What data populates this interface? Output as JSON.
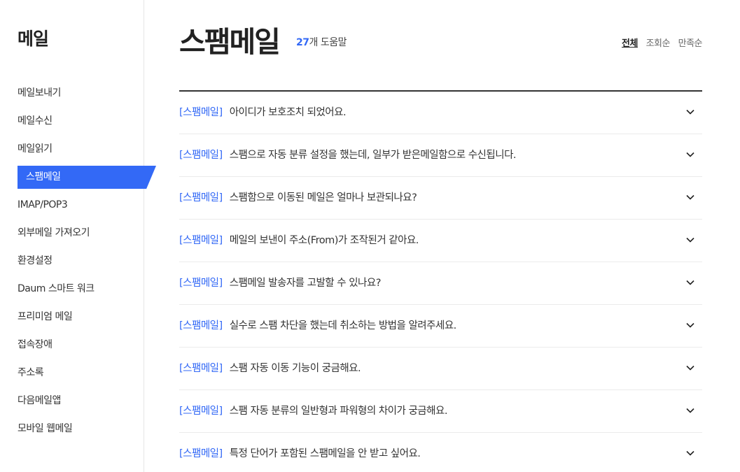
{
  "sidebar": {
    "title": "메일",
    "items": [
      {
        "label": "메일보내기",
        "active": false
      },
      {
        "label": "메일수신",
        "active": false
      },
      {
        "label": "메일읽기",
        "active": false
      },
      {
        "label": "스팸메일",
        "active": true
      },
      {
        "label": "IMAP/POP3",
        "active": false
      },
      {
        "label": "외부메일 가져오기",
        "active": false
      },
      {
        "label": "환경설정",
        "active": false
      },
      {
        "label": "Daum 스마트 워크",
        "active": false
      },
      {
        "label": "프리미엄 메일",
        "active": false
      },
      {
        "label": "접속장애",
        "active": false
      },
      {
        "label": "주소록",
        "active": false
      },
      {
        "label": "다음메일앱",
        "active": false
      },
      {
        "label": "모바일 웹메일",
        "active": false
      }
    ]
  },
  "main": {
    "title": "스팸메일",
    "count_number": "27",
    "count_suffix": "개 도움말",
    "sort": [
      {
        "label": "전체",
        "selected": true
      },
      {
        "label": "조회순",
        "selected": false
      },
      {
        "label": "만족순",
        "selected": false
      }
    ],
    "faq": [
      {
        "category": "[스팸메일]",
        "question": "아이디가 보호조치 되었어요."
      },
      {
        "category": "[스팸메일]",
        "question": "스팸으로 자동 분류 설정을 했는데, 일부가 받은메일함으로 수신됩니다."
      },
      {
        "category": "[스팸메일]",
        "question": "스팸함으로 이동된 메일은 얼마나 보관되나요?"
      },
      {
        "category": "[스팸메일]",
        "question": "메일의 보낸이 주소(From)가 조작된거 같아요."
      },
      {
        "category": "[스팸메일]",
        "question": "스팸메일 발송자를 고발할 수 있나요?"
      },
      {
        "category": "[스팸메일]",
        "question": "실수로 스팸 차단을 했는데 취소하는 방법을 알려주세요."
      },
      {
        "category": "[스팸메일]",
        "question": "스팸 자동 이동 기능이 궁금해요."
      },
      {
        "category": "[스팸메일]",
        "question": "스팸 자동 분류의 일반형과 파워형의 차이가 궁금해요."
      },
      {
        "category": "[스팸메일]",
        "question": "특정 단어가 포함된 스팸메일을 안 받고 싶어요."
      }
    ],
    "expand_icon": "chevron-down-icon"
  },
  "colors": {
    "accent": "#3369f6",
    "text": "#333333",
    "title": "#222222",
    "divider": "#ebebeb"
  }
}
